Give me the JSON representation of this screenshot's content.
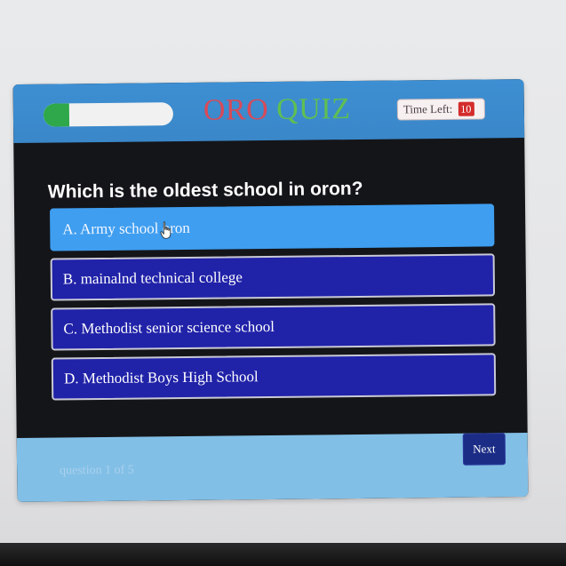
{
  "header": {
    "title_part1": "ORO ",
    "title_part2": "QUIZ",
    "timer_label": "Time Left:",
    "timer_value": "10",
    "progress_fraction": 0.2
  },
  "question": {
    "text": "Which is the oldest school in oron?"
  },
  "options": [
    {
      "label": "A. Army school oron",
      "selected": true
    },
    {
      "label": "B. mainalnd technical college",
      "selected": false
    },
    {
      "label": "C. Methodist senior science school",
      "selected": false
    },
    {
      "label": "D. Methodist Boys High School",
      "selected": false
    }
  ],
  "footer": {
    "counter": "question 1 of 5",
    "next_label": "Next"
  },
  "colors": {
    "header": "#3a87c9",
    "body": "#141519",
    "option": "#2022a8",
    "option_selected": "#3f9ef0",
    "footer": "#82bfe6",
    "progress": "#2ea84a",
    "timer_badge": "#d42b2b"
  },
  "icons": {
    "cursor": "hand-pointer-icon"
  }
}
